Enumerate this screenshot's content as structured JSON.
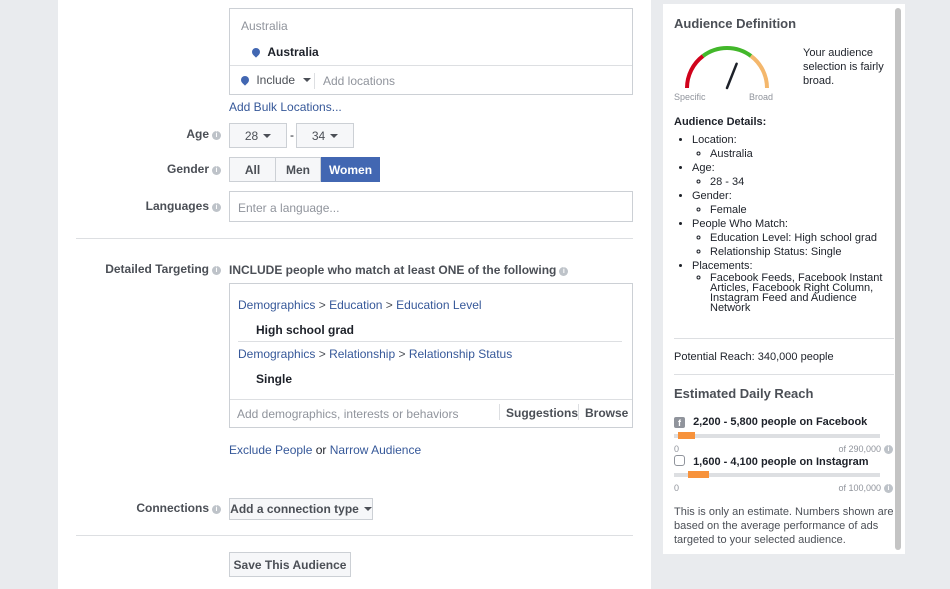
{
  "location": {
    "country_heading": "Australia",
    "selected_location": "Australia",
    "include_label": "Include",
    "add_locations_placeholder": "Add locations",
    "add_bulk_link": "Add Bulk Locations..."
  },
  "age": {
    "label": "Age",
    "min": "28",
    "separator": "-",
    "max": "34"
  },
  "gender": {
    "label": "Gender",
    "options": [
      "All",
      "Men",
      "Women"
    ],
    "selected": "Women"
  },
  "languages": {
    "label": "Languages",
    "placeholder": "Enter a language..."
  },
  "detailed_targeting": {
    "label": "Detailed Targeting",
    "instruction": "INCLUDE people who match at least ONE of the following",
    "groups": [
      {
        "crumbs": [
          "Demographics",
          "Education",
          "Education Level"
        ],
        "value": "High school grad"
      },
      {
        "crumbs": [
          "Demographics",
          "Relationship",
          "Relationship Status"
        ],
        "value": "Single"
      }
    ],
    "crumb_separator": ">",
    "add_placeholder": "Add demographics, interests or behaviors",
    "suggestions_label": "Suggestions",
    "browse_label": "Browse",
    "exclude_link": "Exclude People",
    "or_text": "or",
    "narrow_link": "Narrow Audience"
  },
  "connections": {
    "label": "Connections",
    "dropdown_label": "Add a connection type"
  },
  "save_button": "Save This Audience",
  "sidebar": {
    "title": "Audience Definition",
    "gauge": {
      "specific_label": "Specific",
      "broad_label": "Broad",
      "level": 0.62
    },
    "gauge_text": "Your audience selection is fairly broad.",
    "details_title": "Audience Details:",
    "details": [
      {
        "label": "Location:",
        "values": [
          "Australia"
        ]
      },
      {
        "label": "Age:",
        "values": [
          "28 - 34"
        ]
      },
      {
        "label": "Gender:",
        "values": [
          "Female"
        ]
      },
      {
        "label": "People Who Match:",
        "values": [
          "Education Level: High school grad",
          "Relationship Status: Single"
        ]
      },
      {
        "label": "Placements:",
        "values": [
          "Facebook Feeds, Facebook Instant Articles, Facebook Right Column, Instagram Feed and Audience Network"
        ]
      }
    ],
    "potential_reach": "Potential Reach: 340,000 people",
    "daily_reach_title": "Estimated Daily Reach",
    "facebook": {
      "text": "2,200 - 5,800 people on Facebook",
      "min_label": "0",
      "max_label": "of 290,000",
      "range": [
        0.02,
        0.1
      ]
    },
    "instagram": {
      "text": "1,600 - 4,100 people on Instagram",
      "min_label": "0",
      "max_label": "of 100,000",
      "range": [
        0.07,
        0.17
      ]
    },
    "disclaimer": "This is only an estimate. Numbers shown are based on the average performance of ads targeted to your selected audience."
  },
  "colors": {
    "accent": "#4267b2",
    "link": "#365899",
    "reach_bar": "#f7923b",
    "gauge_green": "#42b72a",
    "gauge_red": "#d0021b",
    "gauge_orange": "#f4b76c"
  }
}
